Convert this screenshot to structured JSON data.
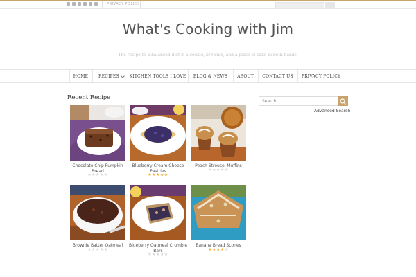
{
  "topbar": {
    "social_icons": [
      "rss-icon",
      "pinterest-icon",
      "twitter-icon",
      "facebook-icon",
      "google-plus-icon",
      "instagram-icon"
    ],
    "privacy_link": "PRIVACY POLICY"
  },
  "header": {
    "title": "What's Cooking with Jim",
    "tagline": "The recipe to a balanced diet is a cookie, brownie, and a piece of cake in both hands."
  },
  "nav": {
    "items": [
      {
        "label": "HOME"
      },
      {
        "label": "RECIPES"
      },
      {
        "label": "KITCHEN TOOLS I LOVE"
      },
      {
        "label": "BLOG & NEWS"
      },
      {
        "label": "ABOUT"
      },
      {
        "label": "CONTACT US"
      },
      {
        "label": "PRIVACY POLICY"
      }
    ]
  },
  "main": {
    "section_title": "Recent Recipe",
    "recipes": [
      {
        "title_lines": [
          "Chocolate Chip Pumpkin",
          "Bread"
        ],
        "rating": 0
      },
      {
        "title_lines": [
          "Blueberry Cream Cheese",
          "Pastries"
        ],
        "rating": 5
      },
      {
        "title_lines": [
          "Peach Streusel Muffins"
        ],
        "rating": 0
      },
      {
        "title_lines": [
          "Brownie Batter Oatmeal"
        ],
        "rating": 0
      },
      {
        "title_lines": [
          "Blueberry Oatmeal Crumble",
          "Bars"
        ],
        "rating": 0
      },
      {
        "title_lines": [
          "Banana Bread Scones"
        ],
        "rating": 4
      }
    ]
  },
  "sidebar": {
    "search_placeholder": "Search...",
    "advanced_search": "Advanced Search"
  },
  "colors": {
    "accent": "#c8a36a",
    "star_on": "#f0a420",
    "star_off": "#d5d5d5"
  }
}
